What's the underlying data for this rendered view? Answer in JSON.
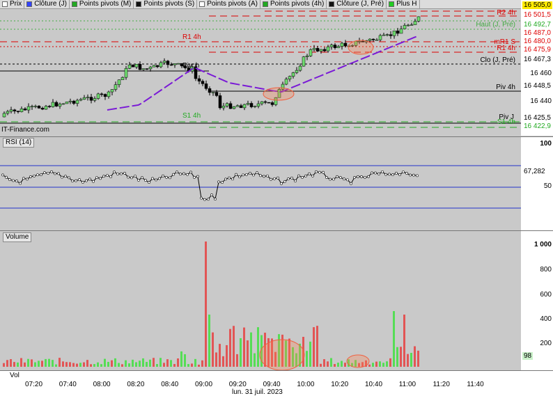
{
  "legend": [
    {
      "name": "price",
      "label": "Prix",
      "color": "#ffffff"
    },
    {
      "name": "close-day",
      "label": "Clôture (J)",
      "color": "#3344ff"
    },
    {
      "name": "pivots-month",
      "label": "Points pivots (M)",
      "color": "#22aa22"
    },
    {
      "name": "pivots-week",
      "label": "Points pivots (S)",
      "color": "#111111"
    },
    {
      "name": "pivots-year",
      "label": "Points pivots (A)",
      "color": "#ffffff"
    },
    {
      "name": "pivots-4h",
      "label": "Points pivots (4h)",
      "color": "#22aa22"
    },
    {
      "name": "close-day-pre",
      "label": "Clôture (J, Pré)",
      "color": "#111111"
    },
    {
      "name": "more",
      "label": "Plus H",
      "color": "#22cc22"
    }
  ],
  "price_axis": {
    "ticks": [
      "16 460",
      "16 440"
    ],
    "tags": [
      {
        "text": "16 505,0",
        "bg": "#ffeb00",
        "color": "#000"
      },
      {
        "text": "16 501,5",
        "bg": "#ffffff",
        "color": "#d00"
      },
      {
        "text": "16 492,7",
        "bg": "#ffffff",
        "color": "#2a2"
      },
      {
        "text": "16 487,0",
        "bg": "#ffffff",
        "color": "#d00"
      },
      {
        "text": "16 480,0",
        "bg": "#ffffff",
        "color": "#d00"
      },
      {
        "text": "16 475,9",
        "bg": "#ffffff",
        "color": "#d00"
      },
      {
        "text": "16 467,3",
        "bg": "#ffffff",
        "color": "#000"
      },
      {
        "text": "16 448,5",
        "bg": "#ffffff",
        "color": "#000"
      },
      {
        "text": "16 425,5",
        "bg": "#ffffff",
        "color": "#000"
      },
      {
        "text": "16 422,9",
        "bg": "#ffffff",
        "color": "#2a2"
      }
    ]
  },
  "levels": {
    "r2_4h": "R2 4h",
    "high_day": "Haut (J, Pré)",
    "r1_4h_left": "R1 4h",
    "mr1_s": "mR1 S",
    "r1_4h_right": "R1 4h",
    "close_day": "Clo (J, Pré)",
    "piv_4h": "Piv 4h",
    "pivot_label": "Piv..h",
    "s1_4h": "S1 4h",
    "piv_j": "Piv J",
    "s1_4h_b": "S1 4h"
  },
  "watermark": "IT-Finance.com",
  "rsi": {
    "title": "RSI (14)",
    "ticks": [
      "100",
      "50"
    ],
    "value": "67,282"
  },
  "volume": {
    "title": "Volume",
    "ticks": [
      "1 000",
      "800",
      "600",
      "400",
      "200"
    ],
    "value": "98"
  },
  "vol_label": "Vol",
  "time_axis": {
    "labels": [
      "07:20",
      "07:40",
      "08:00",
      "08:20",
      "08:40",
      "09:00",
      "09:20",
      "09:40",
      "10:00",
      "10:20",
      "10:40",
      "11:00",
      "11:20",
      "11:40"
    ],
    "date": "lun. 31 juil. 2023"
  }
}
